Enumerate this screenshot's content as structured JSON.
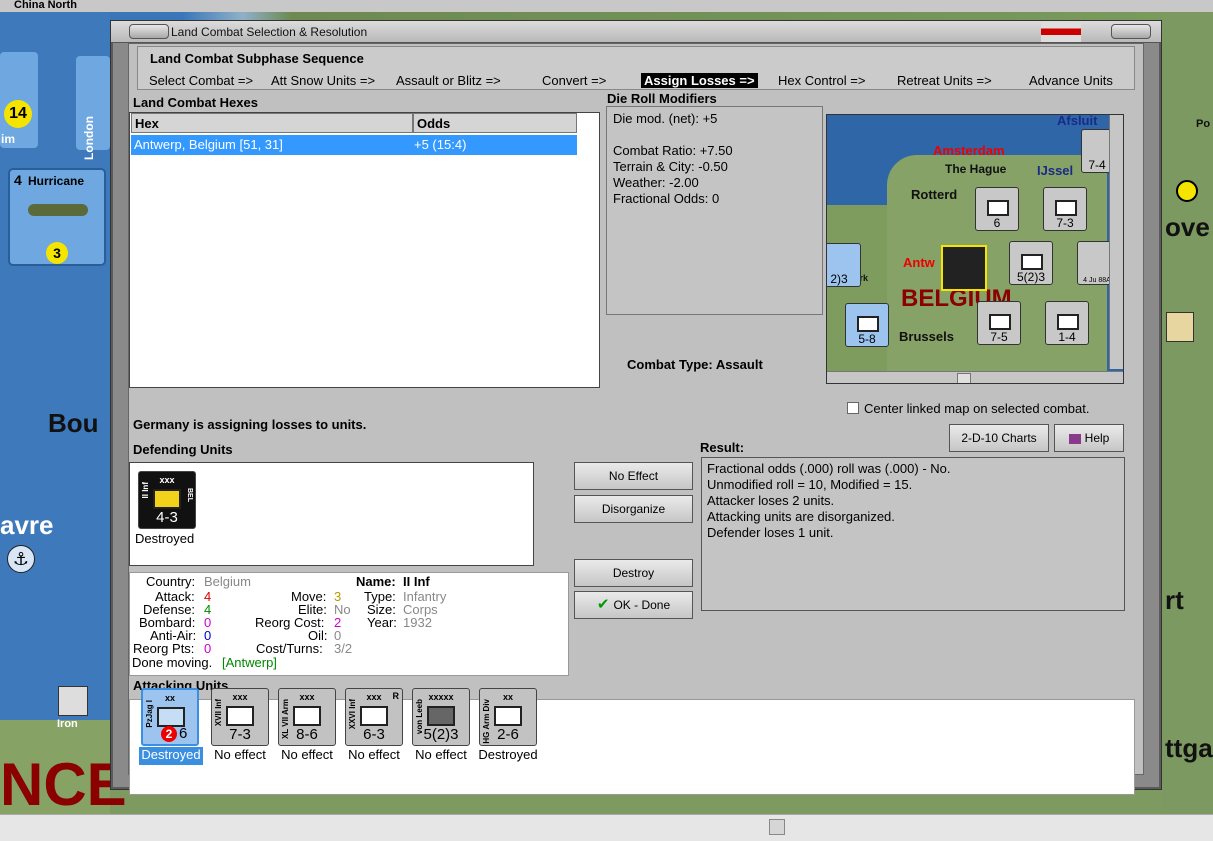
{
  "window": {
    "top_title": "China North",
    "title": "Land Combat Selection & Resolution"
  },
  "phase_sequence": {
    "title": "Land Combat Subphase Sequence",
    "steps": [
      "Select Combat =>",
      "Att Snow Units =>",
      "Assault or Blitz =>",
      "Convert =>",
      "Assign Losses =>",
      "Hex Control =>",
      "Retreat Units =>",
      "Advance Units"
    ],
    "active_index": 4
  },
  "hexes": {
    "title": "Land Combat Hexes",
    "columns": [
      "Hex",
      "Odds"
    ],
    "rows": [
      {
        "hex": "Antwerp, Belgium [51, 31]",
        "odds": "+5 (15:4)"
      }
    ]
  },
  "die_roll": {
    "title": "Die Roll Modifiers",
    "net": "Die mod. (net): +5",
    "combat_ratio": "Combat Ratio: +7.50",
    "terrain": "Terrain & City: -0.50",
    "weather": "Weather: -2.00",
    "fractional": "Fractional Odds: 0"
  },
  "combat_type": "Combat Type:  Assault",
  "center_map_label": "Center linked map on selected combat.",
  "assign_msg": "Germany is assigning losses to units.",
  "defending": {
    "title": "Defending Units",
    "units": [
      {
        "side": "II Inf",
        "size": "xxx",
        "tag": "BEL",
        "value": "4-3",
        "status": "Destroyed",
        "color": "#f2d21a"
      }
    ]
  },
  "details": {
    "country_label": "Country:",
    "country": "Belgium",
    "attack_label": "Attack:",
    "attack": "4",
    "defense_label": "Defense:",
    "defense": "4",
    "bombard_label": "Bombard:",
    "bombard": "0",
    "antiair_label": "Anti-Air:",
    "antiair": "0",
    "reorg_pts_label": "Reorg Pts:",
    "reorg_pts": "0",
    "move_label": "Move:",
    "move": "3",
    "elite_label": "Elite:",
    "elite": "No",
    "reorg_cost_label": "Reorg Cost:",
    "reorg_cost": "2",
    "oil_label": "Oil:",
    "oil": "0",
    "cost_label": "Cost/Turns:",
    "cost": "3/2",
    "name_label": "Name:",
    "name": "II Inf",
    "type_label": "Type:",
    "type": "Infantry",
    "size_label": "Size:",
    "size": "Corps",
    "year_label": "Year:",
    "year": "1932",
    "done_moving": "Done moving.",
    "location": "[Antwerp]"
  },
  "buttons": {
    "no_effect": "No Effect",
    "disorganize": "Disorganize",
    "destroy": "Destroy",
    "ok_done": "OK - Done",
    "charts": "2-D-10 Charts",
    "help": "Help"
  },
  "result": {
    "title": "Result:",
    "lines": [
      "Fractional odds (.000) roll was (.000)  - No.",
      "Unmodified roll = 10, Modified = 15.",
      "Attacker loses 2 units.",
      "Attacking units are disorganized.",
      "Defender loses 1 unit."
    ]
  },
  "attacking": {
    "title": "Attacking Units",
    "units": [
      {
        "side": "PzJag I",
        "size": "xx",
        "value": "6",
        "badge": "2",
        "status": "Destroyed",
        "selected": true
      },
      {
        "side": "XVII Inf",
        "size": "xxx",
        "value": "7-3",
        "status": "No effect"
      },
      {
        "side": "XL VII Arm",
        "size": "xxx",
        "value": "8-6",
        "status": "No effect"
      },
      {
        "side": "XXVI Inf",
        "size": "xxx",
        "value": "6-3",
        "status": "No effect",
        "r": "R"
      },
      {
        "side": "von Leeb",
        "size": "xxxxx",
        "value": "5(2)3",
        "status": "No effect"
      },
      {
        "side": "HG Arm Div",
        "size": "xx",
        "value": "2-6",
        "status": "Destroyed"
      }
    ]
  },
  "map": {
    "labels": [
      "China North",
      "Bou",
      "avre",
      "Iron",
      "Hurricane",
      "London",
      "ove",
      "rt",
      "ttga",
      "Po"
    ],
    "minimap_labels": [
      "Amsterdam",
      "The Hague",
      "IJssel",
      "Rotterd",
      "Antw",
      "BELGIUM",
      "Brussels",
      "Afsluit",
      "unkirk"
    ],
    "minimap_values": [
      "7-4",
      "6",
      "7-3",
      "5(2)3",
      "4 Ju 88A",
      "7-5",
      "1-4",
      "5-8",
      "2)3"
    ]
  }
}
